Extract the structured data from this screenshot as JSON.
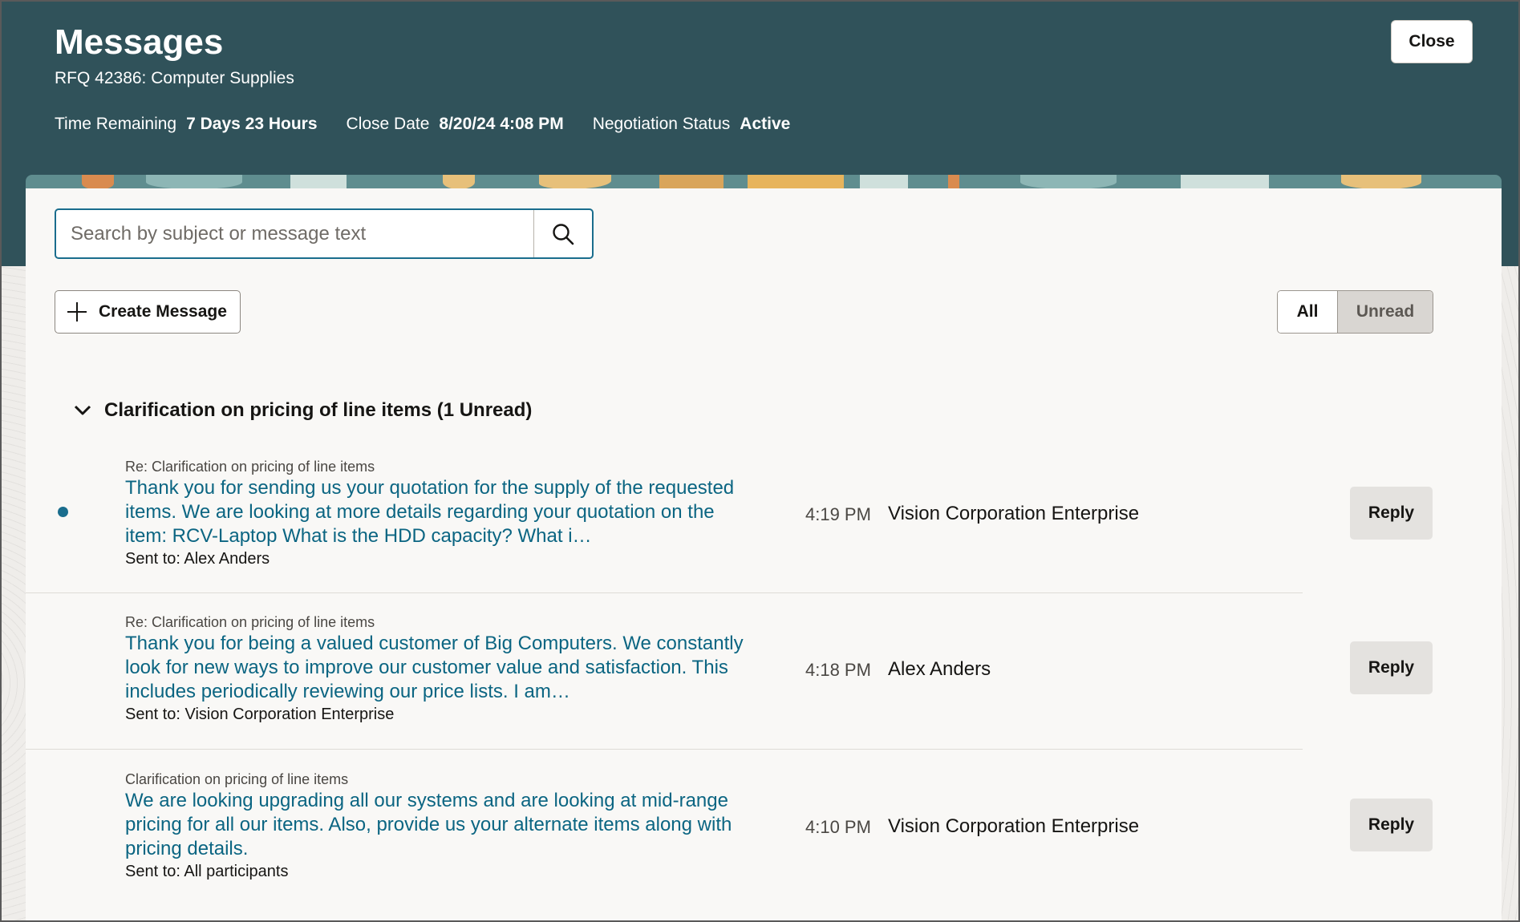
{
  "header": {
    "title": "Messages",
    "subtitle": "RFQ 42386: Computer Supplies",
    "time_remaining_label": "Time Remaining",
    "time_remaining_value": "7 Days 23 Hours",
    "close_date_label": "Close Date",
    "close_date_value": "8/20/24 4:08 PM",
    "status_label": "Negotiation Status",
    "status_value": "Active",
    "close_button": "Close"
  },
  "search": {
    "placeholder": "Search by subject or message text",
    "icon": "search-icon"
  },
  "toolbar": {
    "create_label": "Create Message",
    "filter_all": "All",
    "filter_unread": "Unread",
    "active_filter": "Unread"
  },
  "group": {
    "title": "Clarification on pricing of line items (1 Unread)",
    "expanded": true
  },
  "messages": [
    {
      "subject": "Re: Clarification on pricing of line items",
      "body": "Thank you for sending us your quotation for the supply of the requested items. We are looking at more details regarding your quotation on the item: RCV-Laptop What is the HDD capacity? What i…",
      "sent_to": "Sent to: Alex Anders",
      "time": "4:19 PM",
      "sender": "Vision Corporation Enterprise",
      "unread": true,
      "reply_label": "Reply"
    },
    {
      "subject": "Re: Clarification on pricing of line items",
      "body": "Thank you for being a valued customer of Big Computers. We constantly look for new ways to improve our customer value and satisfaction. This includes periodically reviewing our price lists. I am…",
      "sent_to": "Sent to: Vision Corporation Enterprise",
      "time": "4:18 PM",
      "sender": "Alex Anders",
      "unread": false,
      "reply_label": "Reply"
    },
    {
      "subject": "Clarification on pricing of line items",
      "body": "We are looking upgrading all our systems and are looking at mid-range pricing for all our items. Also, provide us your alternate items along with pricing details.",
      "sent_to": "Sent to: All participants",
      "time": "4:10 PM",
      "sender": "Vision Corporation Enterprise",
      "unread": false,
      "reply_label": "Reply"
    }
  ],
  "colors": {
    "header_bg": "#30525a",
    "link": "#0b6582",
    "unread_dot": "#1a6d8d"
  }
}
